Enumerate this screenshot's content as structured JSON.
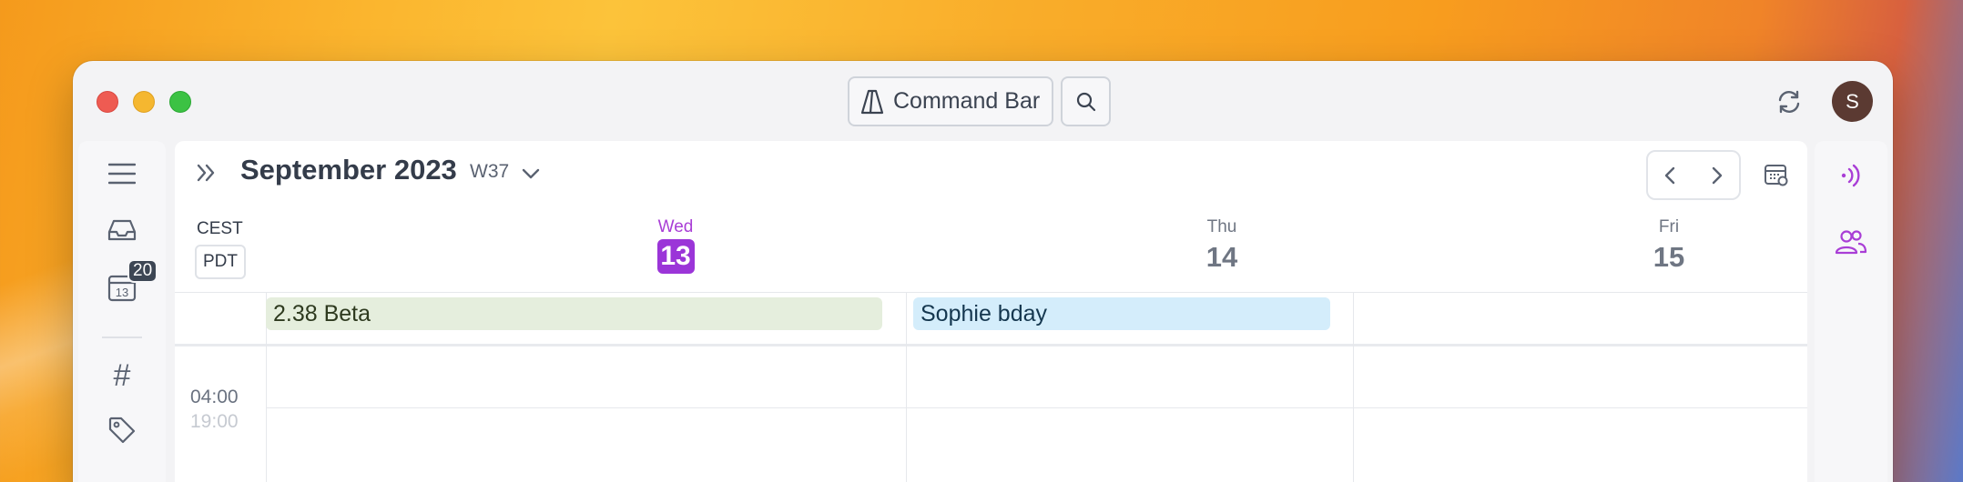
{
  "titlebar": {
    "command_bar_label": "Command Bar",
    "avatar_initial": "S"
  },
  "sidebar": {
    "inbox_icon": "inbox-icon",
    "calendar_icon_day": "13",
    "calendar_badge_count": "20",
    "hashtag_icon": "#"
  },
  "header": {
    "month_title": "September 2023",
    "week_label": "W37"
  },
  "timezones": {
    "primary": "CEST",
    "secondary": "PDT"
  },
  "days": [
    {
      "name": "Wed",
      "number": "13",
      "today": true
    },
    {
      "name": "Thu",
      "number": "14",
      "today": false
    },
    {
      "name": "Fri",
      "number": "15",
      "today": false
    }
  ],
  "all_day_events": [
    {
      "title": "2.38 Beta",
      "color": "#e5eedd"
    },
    {
      "title": "Sophie bday",
      "color": "#d4edfb"
    }
  ],
  "time_rows": [
    {
      "primary": "04:00",
      "secondary": "19:00"
    }
  ],
  "accent_color": "#9b35d8"
}
